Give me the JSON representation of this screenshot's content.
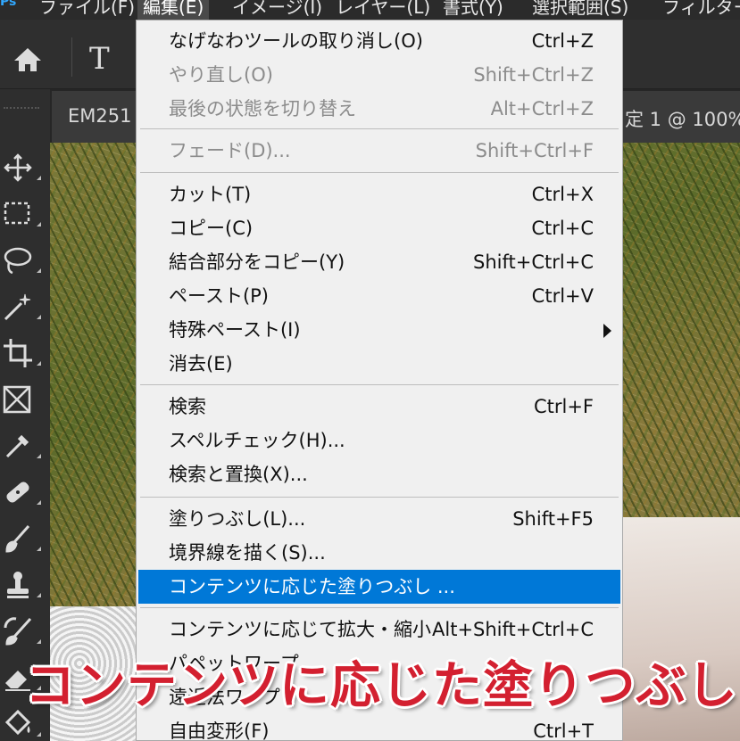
{
  "menubar": {
    "logo": "Ps",
    "items": [
      {
        "label": "ファイル(F)"
      },
      {
        "label": "編集(E)"
      },
      {
        "label": "イメージ(I)"
      },
      {
        "label": "レイヤー(L)"
      },
      {
        "label": "書式(Y)"
      },
      {
        "label": "選択範囲(S)"
      },
      {
        "label": "フィルター"
      }
    ]
  },
  "optionsbar": {
    "home_icon": "home-icon",
    "type_icon_label": "T"
  },
  "document_tab": {
    "left_text": "EM251",
    "right_text": "定 1 @ 100%"
  },
  "toolbar": {
    "tools": [
      "move-icon",
      "marquee-icon",
      "lasso-icon",
      "magic-wand-icon",
      "crop-icon",
      "frame-icon",
      "eyedropper-icon",
      "healing-brush-icon",
      "brush-icon",
      "clone-stamp-icon",
      "history-brush-icon",
      "eraser-icon",
      "paint-bucket-icon"
    ]
  },
  "edit_menu": {
    "items": [
      {
        "label": "なげなわツールの取り消し(O)",
        "shortcut": "Ctrl+Z",
        "disabled": false
      },
      {
        "label": "やり直し(O)",
        "shortcut": "Shift+Ctrl+Z",
        "disabled": true
      },
      {
        "label": "最後の状態を切り替え",
        "shortcut": "Alt+Ctrl+Z",
        "disabled": true
      },
      {
        "label": "フェード(D)...",
        "shortcut": "Shift+Ctrl+F",
        "disabled": true
      },
      {
        "label": "カット(T)",
        "shortcut": "Ctrl+X",
        "disabled": false
      },
      {
        "label": "コピー(C)",
        "shortcut": "Ctrl+C",
        "disabled": false
      },
      {
        "label": "結合部分をコピー(Y)",
        "shortcut": "Shift+Ctrl+C",
        "disabled": false
      },
      {
        "label": "ペースト(P)",
        "shortcut": "Ctrl+V",
        "disabled": false
      },
      {
        "label": "特殊ペースト(I)",
        "shortcut": "",
        "disabled": false,
        "submenu": true
      },
      {
        "label": "消去(E)",
        "shortcut": "",
        "disabled": false
      },
      {
        "label": "検索",
        "shortcut": "Ctrl+F",
        "disabled": false
      },
      {
        "label": "スペルチェック(H)...",
        "shortcut": "",
        "disabled": false
      },
      {
        "label": "検索と置換(X)...",
        "shortcut": "",
        "disabled": false
      },
      {
        "label": "塗りつぶし(L)...",
        "shortcut": "Shift+F5",
        "disabled": false
      },
      {
        "label": "境界線を描く(S)...",
        "shortcut": "",
        "disabled": false
      },
      {
        "label": "コンテンツに応じた塗りつぶし ...",
        "shortcut": "",
        "disabled": false,
        "highlighted": true
      },
      {
        "label": "コンテンツに応じて拡大・縮小",
        "shortcut": "Alt+Shift+Ctrl+C",
        "disabled": false
      },
      {
        "label": "パペットワープ",
        "shortcut": "",
        "disabled": false
      },
      {
        "label": "遠近法ワープ",
        "shortcut": "",
        "disabled": false
      },
      {
        "label": "自由変形(F)",
        "shortcut": "Ctrl+T",
        "disabled": false
      }
    ]
  },
  "caption": {
    "text": "コンテンツに応じた塗りつぶし",
    "color": "#d32030"
  },
  "colors": {
    "highlight": "#0078d7",
    "menu_bg": "#f0f0f0",
    "app_bg": "#2b2b2b"
  }
}
